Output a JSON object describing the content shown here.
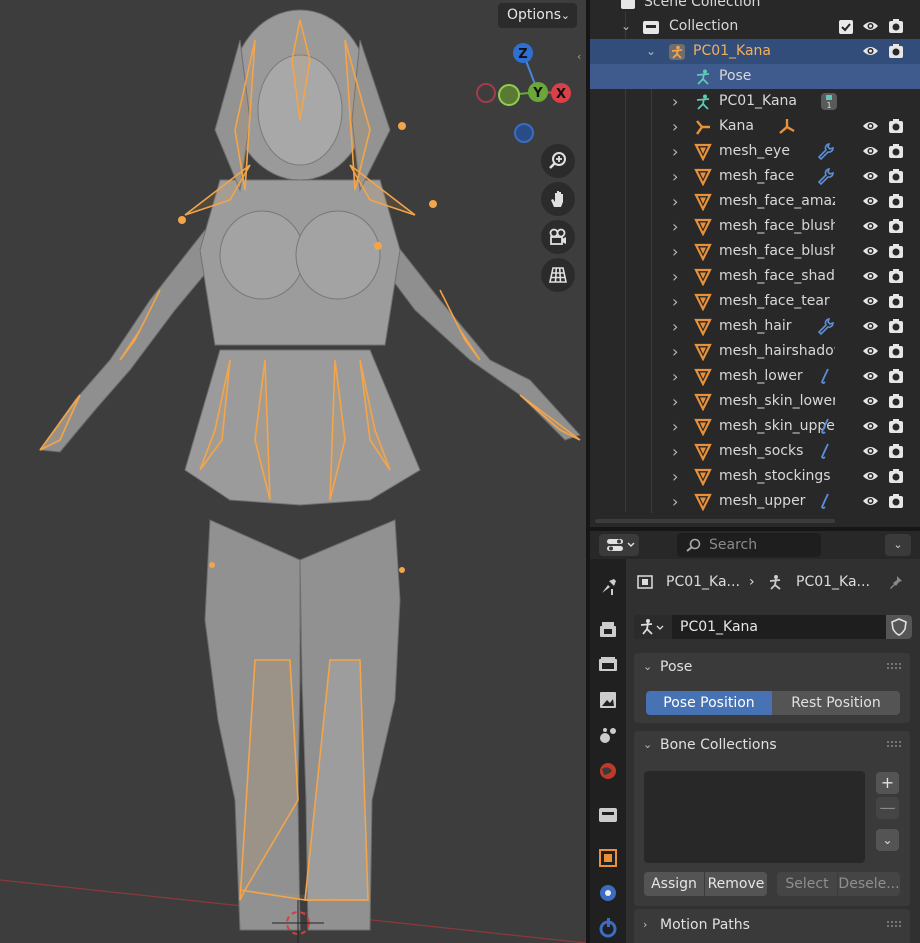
{
  "viewport": {
    "options_label": "Options",
    "gizmo": {
      "z": "Z",
      "y": "Y",
      "x": "X"
    }
  },
  "outliner": {
    "scene_collection": "Scene Collection",
    "collection": "Collection",
    "rows": [
      {
        "label": "PC01_Kana",
        "icon": "armature-object-icon",
        "modifier": "",
        "has_vis": true
      },
      {
        "label": "Pose",
        "icon": "pose-icon",
        "modifier": "",
        "has_vis": false
      },
      {
        "label": "PC01_Kana",
        "icon": "armature-data-icon",
        "modifier": "data-badge-icon",
        "has_vis": false
      },
      {
        "label": "Kana",
        "icon": "armature-icon",
        "modifier": "armature-data-icon",
        "has_vis": true
      },
      {
        "label": "mesh_eye",
        "icon": "mesh-icon",
        "modifier": "wrench-icon",
        "has_vis": true
      },
      {
        "label": "mesh_face",
        "icon": "mesh-icon",
        "modifier": "wrench-icon",
        "has_vis": true
      },
      {
        "label": "mesh_face_amaze",
        "icon": "mesh-icon",
        "modifier": "",
        "has_vis": true
      },
      {
        "label": "mesh_face_blush",
        "icon": "mesh-icon",
        "modifier": "",
        "has_vis": true
      },
      {
        "label": "mesh_face_blush",
        "icon": "mesh-icon",
        "modifier": "",
        "has_vis": true
      },
      {
        "label": "mesh_face_shado",
        "icon": "mesh-icon",
        "modifier": "",
        "has_vis": true
      },
      {
        "label": "mesh_face_tear",
        "icon": "mesh-icon",
        "modifier": "",
        "has_vis": true
      },
      {
        "label": "mesh_hair",
        "icon": "mesh-icon",
        "modifier": "wrench-icon",
        "has_vis": true
      },
      {
        "label": "mesh_hairshadow",
        "icon": "mesh-icon",
        "modifier": "",
        "has_vis": true
      },
      {
        "label": "mesh_lower",
        "icon": "mesh-icon",
        "modifier": "bone-icon",
        "has_vis": true
      },
      {
        "label": "mesh_skin_lower",
        "icon": "mesh-icon",
        "modifier": "",
        "has_vis": true
      },
      {
        "label": "mesh_skin_upper",
        "icon": "mesh-icon",
        "modifier": "bone-icon",
        "has_vis": true
      },
      {
        "label": "mesh_socks",
        "icon": "mesh-icon",
        "modifier": "bone-icon",
        "has_vis": true
      },
      {
        "label": "mesh_stockings",
        "icon": "mesh-icon",
        "modifier": "",
        "has_vis": true
      },
      {
        "label": "mesh_upper",
        "icon": "mesh-icon",
        "modifier": "bone-icon",
        "has_vis": true
      }
    ]
  },
  "properties": {
    "search_placeholder": "Search",
    "breadcrumb": {
      "object": "PC01_Ka...",
      "data": "PC01_Ka..."
    },
    "datablock_name": "PC01_Kana",
    "pose_panel": {
      "title": "Pose",
      "pose_position": "Pose Position",
      "rest_position": "Rest Position"
    },
    "bone_collections": {
      "title": "Bone Collections",
      "assign": "Assign",
      "remove": "Remove",
      "select": "Select",
      "deselect": "Desele..."
    },
    "motion_paths": {
      "title": "Motion Paths"
    }
  },
  "colors": {
    "accent": "#4772b3",
    "armature_orange": "#f2a54a",
    "active_row": "#334d7a",
    "pose_green": "#5fc9b6",
    "mesh_orange": "#e8913a"
  }
}
